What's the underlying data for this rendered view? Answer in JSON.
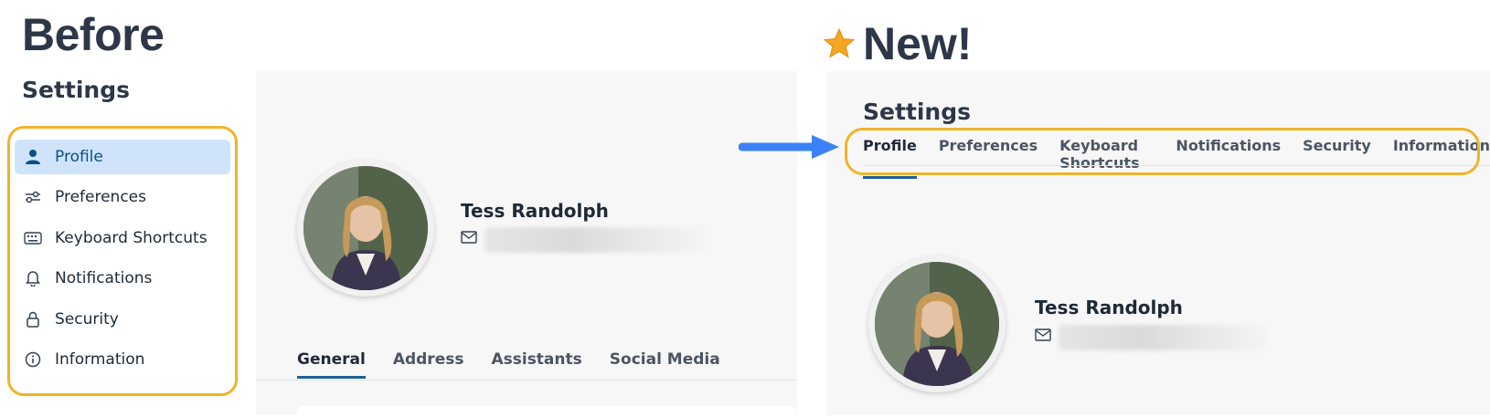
{
  "before": {
    "title": "Before",
    "settings_heading": "Settings",
    "sidebar": {
      "items": [
        {
          "label": "Profile",
          "icon": "person-icon",
          "active": true
        },
        {
          "label": "Preferences",
          "icon": "sliders-icon"
        },
        {
          "label": "Keyboard Shortcuts",
          "icon": "keyboard-icon"
        },
        {
          "label": "Notifications",
          "icon": "bell-icon"
        },
        {
          "label": "Security",
          "icon": "lock-icon"
        },
        {
          "label": "Information",
          "icon": "info-icon"
        }
      ]
    },
    "profile": {
      "name": "Tess Randolph"
    },
    "tabs": [
      "General",
      "Address",
      "Assistants",
      "Social Media"
    ],
    "active_tab": "General"
  },
  "after": {
    "title": "New!",
    "settings_heading": "Settings",
    "tabs": [
      "Profile",
      "Preferences",
      "Keyboard Shortcuts",
      "Notifications",
      "Security",
      "Information"
    ],
    "active_tab": "Profile",
    "profile": {
      "name": "Tess Randolph"
    }
  },
  "colors": {
    "highlight": "#f0b429",
    "active_bg": "#cfe4fb",
    "accent": "#1f5f95",
    "arrow": "#3b82f6",
    "star": "#f5a623"
  }
}
